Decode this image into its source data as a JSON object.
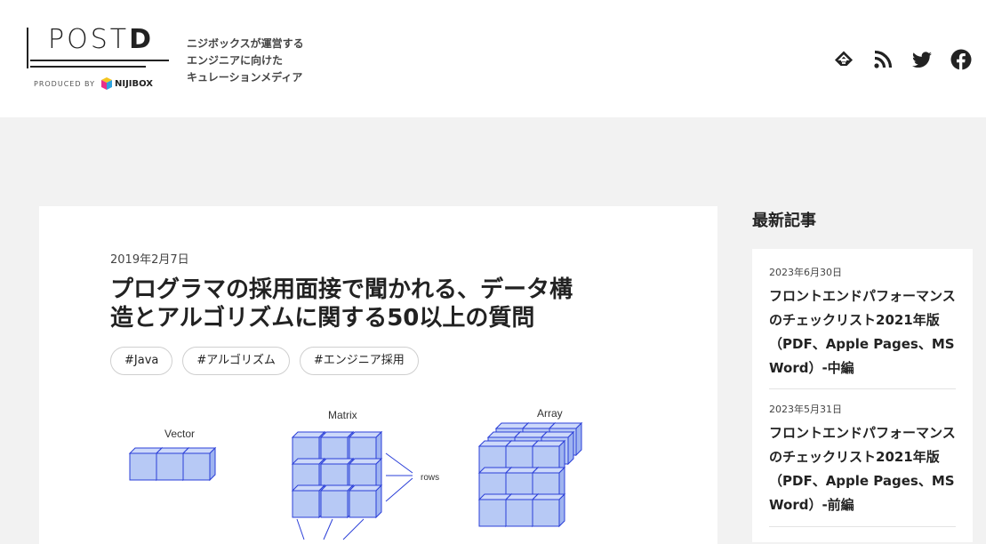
{
  "header": {
    "logo_word_main": "POST",
    "logo_word_d": "D",
    "produced_by": "PRODUCED BY",
    "brand": "NIJIBOX",
    "tagline": [
      "ニジボックスが運営する",
      "エンジニアに向けた",
      "キュレーションメディア"
    ],
    "social_icons": [
      "feedly-icon",
      "rss-icon",
      "twitter-icon",
      "facebook-icon"
    ]
  },
  "article": {
    "date": "2019年2月7日",
    "title_line1": "プログラマの採用面接で聞かれる、データ構",
    "title_line2": "造とアルゴリズムに関する50以上の質問",
    "tags": [
      "#Java",
      "#アルゴリズム",
      "#エンジニア採用"
    ],
    "figure_labels": {
      "vector": "Vector",
      "matrix": "Matrix",
      "array": "Array",
      "rows": "rows"
    }
  },
  "sidebar": {
    "heading": "最新記事",
    "items": [
      {
        "date": "2023年6月30日",
        "title": "フロントエンドパフォーマンスのチェックリスト2021年版（PDF、Apple Pages、MS Word）-中編"
      },
      {
        "date": "2023年5月31日",
        "title": "フロントエンドパフォーマンスのチェックリスト2021年版（PDF、Apple Pages、MS Word）-前編"
      }
    ]
  },
  "colors": {
    "page_bg": "#f2f2f2",
    "card_bg": "#ffffff",
    "cube_fill": "#b7c9f5",
    "cube_stroke": "#2b3fd8"
  }
}
